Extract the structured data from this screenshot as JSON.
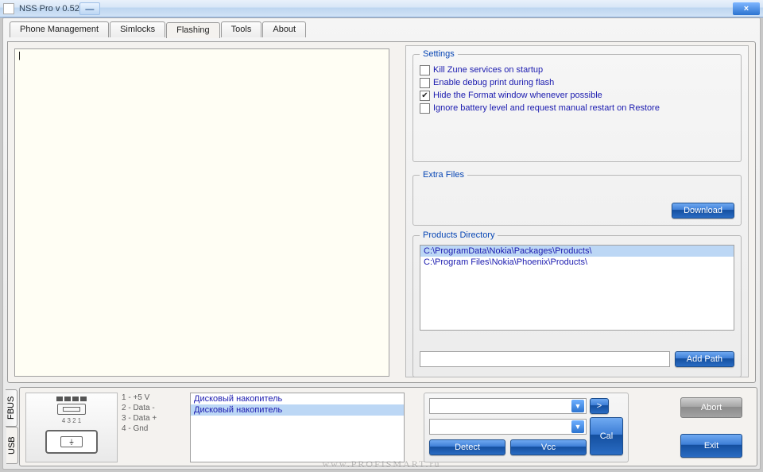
{
  "window": {
    "title": "NSS Pro v 0.52",
    "close": "×",
    "min": "—"
  },
  "tabs": [
    {
      "label": "Phone Management"
    },
    {
      "label": "Simlocks"
    },
    {
      "label": "Flashing"
    },
    {
      "label": "Tools"
    },
    {
      "label": "About"
    }
  ],
  "log": {
    "caret": "|"
  },
  "settings": {
    "legend": "Settings",
    "options": [
      {
        "label": "Kill Zune services on startup",
        "checked": false
      },
      {
        "label": "Enable debug print during flash",
        "checked": false
      },
      {
        "label": "Hide the Format window whenever possible",
        "checked": true
      },
      {
        "label": "Ignore battery level and request manual restart on Restore",
        "checked": false
      }
    ]
  },
  "extra_files": {
    "legend": "Extra Files",
    "download": "Download"
  },
  "products": {
    "legend": "Products Directory",
    "items": [
      {
        "path": "C:\\ProgramData\\Nokia\\Packages\\Products\\",
        "selected": true
      },
      {
        "path": "C:\\Program Files\\Nokia\\Phoenix\\Products\\",
        "selected": false
      }
    ],
    "add_path": "Add Path",
    "input": ""
  },
  "bottom": {
    "vtabs": [
      {
        "label": "FBUS"
      },
      {
        "label": "USB"
      }
    ],
    "pin_legend": [
      "1 - +5 V",
      "2 - Data -",
      "3 - Data +",
      "4 - Gnd"
    ],
    "pin_numbers": "4 3 2 1",
    "disks": [
      {
        "label": "Дисковый накопитель",
        "selected": false
      },
      {
        "label": "Дисковый накопитель",
        "selected": true
      }
    ],
    "buttons": {
      "go": ">",
      "cal": "Cal",
      "detect": "Detect",
      "vcc": "Vcc",
      "abort": "Abort",
      "exit": "Exit"
    }
  },
  "watermark": "www.PROFISMART.ru"
}
